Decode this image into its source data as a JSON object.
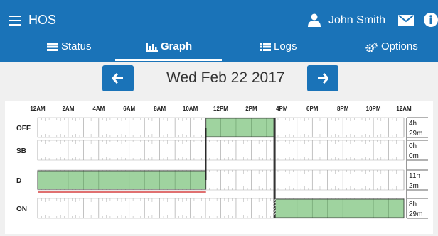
{
  "header": {
    "app_title": "HOS",
    "user_name": "John Smith",
    "icons": {
      "menu": "hamburger-icon",
      "user": "user-icon",
      "mail": "envelope-icon",
      "info": "info-icon"
    }
  },
  "tabs": [
    {
      "label": "Status",
      "icon": "list-icon",
      "active": false
    },
    {
      "label": "Graph",
      "icon": "bar-chart-icon",
      "active": true
    },
    {
      "label": "Logs",
      "icon": "list-icon",
      "active": false
    },
    {
      "label": "Options",
      "icon": "gears-icon",
      "active": false
    }
  ],
  "date_nav": {
    "date": "Wed Feb 22 2017",
    "prev_icon": "arrow-left-icon",
    "next_icon": "arrow-right-icon"
  },
  "colors": {
    "brand": "#1a73b8",
    "duty_fill": "#9fd39f",
    "violation": "#e07070"
  },
  "chart_data": {
    "type": "step",
    "x_ticks": [
      "12AM",
      "2AM",
      "4AM",
      "6AM",
      "8AM",
      "10AM",
      "12PM",
      "2PM",
      "4PM",
      "6PM",
      "8PM",
      "10PM",
      "12AM"
    ],
    "rows": [
      "OFF",
      "SB",
      "D",
      "ON"
    ],
    "totals": [
      {
        "status": "OFF",
        "line1": "4h",
        "line2": "29m"
      },
      {
        "status": "SB",
        "line1": "0h",
        "line2": "0m"
      },
      {
        "status": "D",
        "line1": "11h",
        "line2": "2m"
      },
      {
        "status": "ON",
        "line1": "8h",
        "line2": "29m"
      }
    ],
    "segments": [
      {
        "status": "D",
        "start_hour": 0,
        "end_hour": 11.033
      },
      {
        "status": "OFF",
        "start_hour": 11.033,
        "end_hour": 15.5
      },
      {
        "status": "ON",
        "start_hour": 15.5,
        "end_hour": 24
      }
    ],
    "violation": {
      "status": "D",
      "start_hour": 0,
      "end_hour": 11.033
    }
  }
}
